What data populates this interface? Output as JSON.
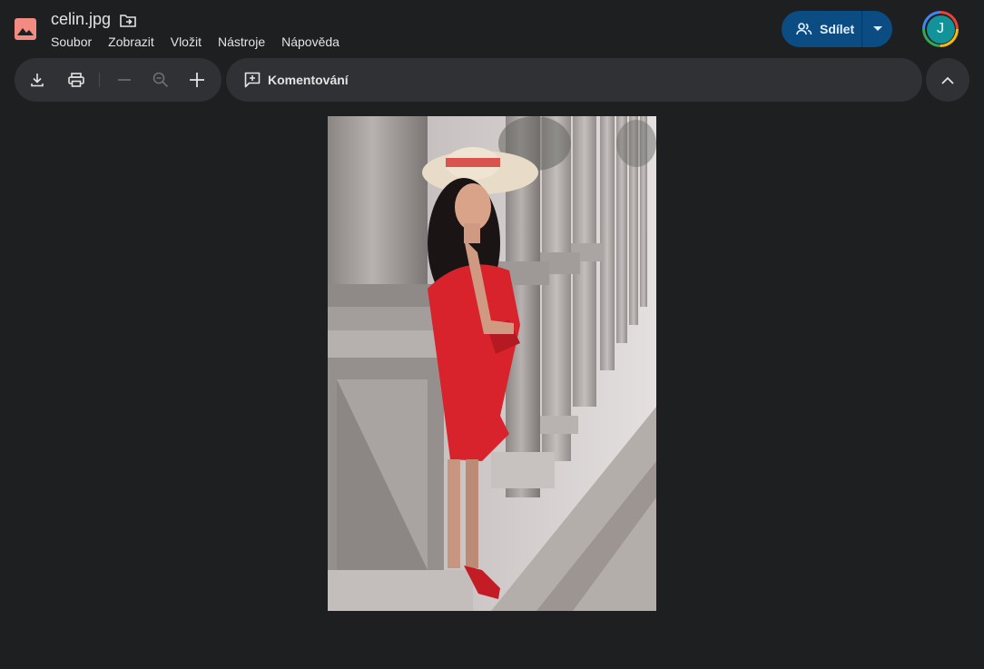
{
  "header": {
    "title": "celin.jpg",
    "menu": [
      "Soubor",
      "Zobrazit",
      "Vložit",
      "Nástroje",
      "Nápověda"
    ]
  },
  "share": {
    "label": "Sdílet"
  },
  "account": {
    "initial": "J"
  },
  "toolbar": {
    "buttons": [
      "download-icon",
      "print-icon",
      "zoom-out-icon",
      "zoom-icon",
      "zoom-in-icon"
    ]
  },
  "comments": {
    "label": "Komentování"
  },
  "colors": {
    "background": "#1e1f20",
    "surface": "#303134",
    "share": "#0b4d83",
    "logo": "#f28b82",
    "avatar": "#12939a"
  },
  "image": {
    "description_icon": "image-icon"
  }
}
